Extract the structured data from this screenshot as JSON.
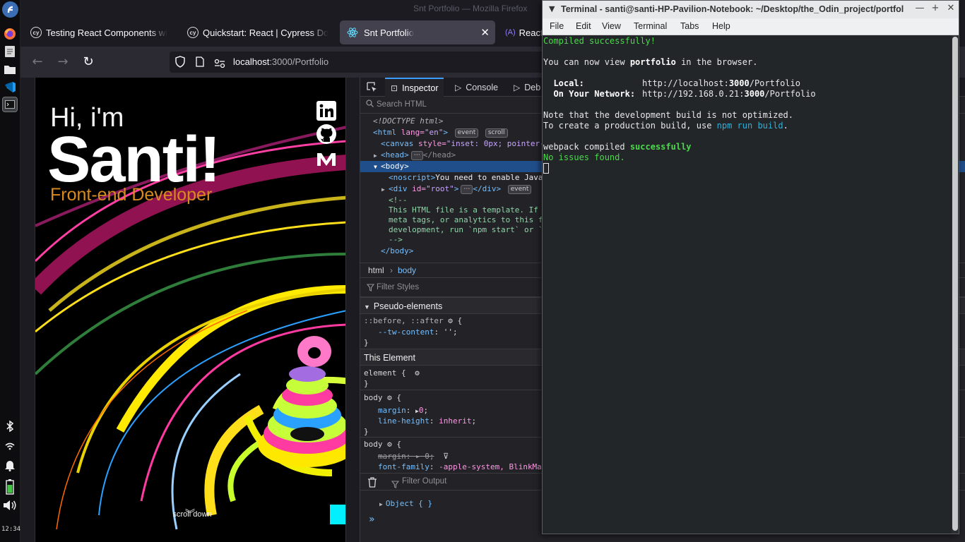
{
  "dock": {
    "time": "12:34",
    "icons": [
      "fedora-logo-icon",
      "firefox-icon",
      "notes-icon",
      "folder-icon",
      "vscode-icon",
      "terminal-icon"
    ],
    "tray": [
      "bluetooth-icon",
      "wifi-icon",
      "bell-icon",
      "battery-icon",
      "volume-icon"
    ]
  },
  "firefox": {
    "window_title": "Snt Portfolio — Mozilla Firefox",
    "tabs": [
      {
        "label": "Testing React Components wi",
        "icon": "cy"
      },
      {
        "label": "Quickstart: React | Cypress Do",
        "icon": "cy"
      },
      {
        "label": "Snt Portfolio",
        "icon": "react"
      },
      {
        "label": "React",
        "icon": "(A)"
      }
    ],
    "close_glyph": "✕",
    "url_host": "localhost",
    "url_path": ":3000/Portfolio"
  },
  "page": {
    "greeting": "Hi, i'm",
    "name": "Santi!",
    "role": "Front-end Developer",
    "social": [
      "in",
      "⌾",
      "M"
    ],
    "scroll_hint": "scroll down",
    "chevron": "︾"
  },
  "devtools": {
    "tabs": [
      {
        "label": "Inspector",
        "icon": "⊡"
      },
      {
        "label": "Console",
        "icon": "▷"
      },
      {
        "label": "Deb",
        "icon": "▷"
      }
    ],
    "search_placeholder": "Search HTML",
    "dom": {
      "doctype": "<!DOCTYPE html>",
      "html_open": "<html",
      "html_attr": " lang=",
      "html_val": "\"en\"",
      "html_close": ">",
      "badge_event": "event",
      "badge_scroll": "scroll",
      "canvas_open": "<canvas",
      "canvas_attr": " style=",
      "canvas_val": "\"inset: 0px; pointer-",
      "head": "<head>",
      "head_close": "</head>",
      "ellipsis": "⋯",
      "body_open": "<body>",
      "noscript_open": "<noscript>",
      "noscript_text": "You need to enable Java",
      "div_open": "<div",
      "div_attr": " id=",
      "div_val": "\"root\"",
      "div_close": ">",
      "div_end": "</div>",
      "comment_open": "<!--",
      "comment_l1": "This HTML file is a template. If",
      "comment_l2": "meta tags, or analytics to this f",
      "comment_l3": "development, run `npm start` or `",
      "comment_close": "-->",
      "body_close": "</body>"
    },
    "breadcrumb": {
      "html": "html",
      "sep": "›",
      "body": "body"
    },
    "filter_styles": "Filter Styles",
    "rules": {
      "pseudo_header": "Pseudo-elements",
      "pseudo_selector": "::before, ::after",
      "open_brace": "{",
      "close_brace": "}",
      "tw_prop": "--tw-content",
      "tw_val": "''",
      "this_element": "This Element",
      "element_selector": "element",
      "body_selector": "body",
      "margin_prop": "margin",
      "margin_val": "0",
      "lh_prop": "line-height",
      "lh_val": "inherit",
      "margin_struck": "margin: ▸ 0;",
      "ff_prop": "font-family",
      "ff_val": "-apple-system, BlinkMa"
    },
    "filter_output": "Filter Output",
    "console_object": "Object {  }",
    "prompt": "»"
  },
  "terminal": {
    "title": "Terminal - santi@santi-HP-Pavilion-Notebook: ~/Desktop/the_Odin_project/portfolio",
    "menu": [
      "File",
      "Edit",
      "View",
      "Terminal",
      "Tabs",
      "Help"
    ],
    "lines": {
      "compiled": "Compiled successfully!",
      "view_pre": "You can now view ",
      "view_app": "portfolio",
      "view_post": " in the browser.",
      "local_label": "  Local:",
      "local_pre": "http://localhost:",
      "local_port": "3000",
      "local_post": "/Portfolio",
      "net_label": "  On Your Network:",
      "net_pre": "http://192.168.0.21:",
      "net_port": "3000",
      "net_post": "/Portfolio",
      "note1": "Note that the development build is not optimized.",
      "note2_pre": "To create a production build, use ",
      "note2_cmd": "npm run build",
      "note2_post": ".",
      "webpack_pre": "webpack compiled ",
      "webpack_ok": "successfully",
      "no_issues": "No issues found."
    }
  },
  "colors": {
    "accent_blue": "#3a9cff",
    "role_orange": "#d88a1e",
    "terminal_green": "#4cd84c",
    "terminal_cyan": "#2fb0d9"
  }
}
